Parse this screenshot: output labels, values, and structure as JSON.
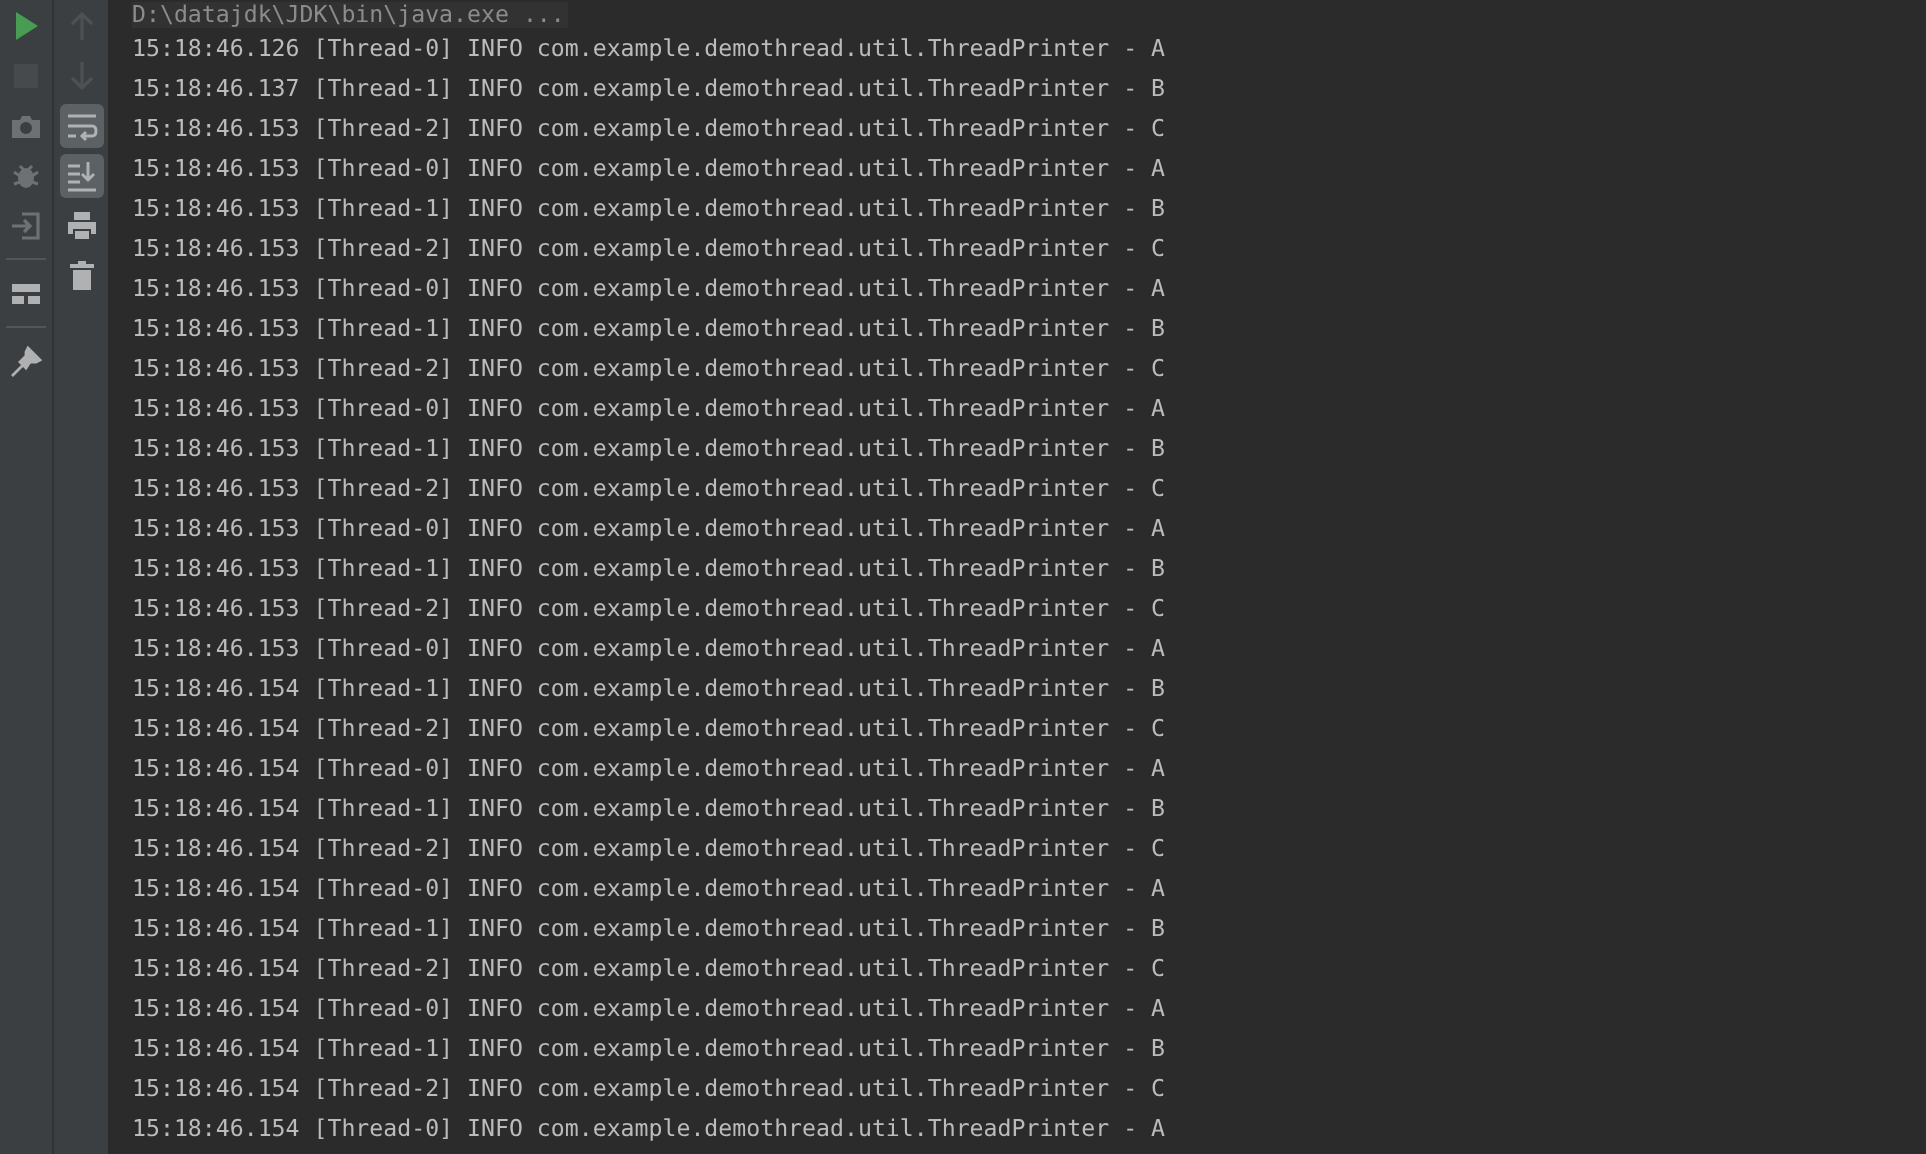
{
  "left_toolbar": [
    {
      "disabled": false
    },
    {
      "disabled": true
    },
    {
      "disabled": false
    },
    {
      "disabled": false
    },
    {
      "disabled": false
    },
    {
      "disabled": false
    },
    {
      "disabled": false
    }
  ],
  "console_toolbar": [
    {
      "disabled": true,
      "on": false
    },
    {
      "disabled": true,
      "on": false
    },
    {
      "disabled": false,
      "on": true
    },
    {
      "disabled": false,
      "on": true
    },
    {
      "disabled": false,
      "on": false
    },
    {
      "disabled": false,
      "on": false
    }
  ],
  "command_line": "D:\\datajdk\\JDK\\bin\\java.exe ...",
  "lines": [
    "15:18:46.126 [Thread-0] INFO com.example.demothread.util.ThreadPrinter - A",
    "15:18:46.137 [Thread-1] INFO com.example.demothread.util.ThreadPrinter - B",
    "15:18:46.153 [Thread-2] INFO com.example.demothread.util.ThreadPrinter - C",
    "15:18:46.153 [Thread-0] INFO com.example.demothread.util.ThreadPrinter - A",
    "15:18:46.153 [Thread-1] INFO com.example.demothread.util.ThreadPrinter - B",
    "15:18:46.153 [Thread-2] INFO com.example.demothread.util.ThreadPrinter - C",
    "15:18:46.153 [Thread-0] INFO com.example.demothread.util.ThreadPrinter - A",
    "15:18:46.153 [Thread-1] INFO com.example.demothread.util.ThreadPrinter - B",
    "15:18:46.153 [Thread-2] INFO com.example.demothread.util.ThreadPrinter - C",
    "15:18:46.153 [Thread-0] INFO com.example.demothread.util.ThreadPrinter - A",
    "15:18:46.153 [Thread-1] INFO com.example.demothread.util.ThreadPrinter - B",
    "15:18:46.153 [Thread-2] INFO com.example.demothread.util.ThreadPrinter - C",
    "15:18:46.153 [Thread-0] INFO com.example.demothread.util.ThreadPrinter - A",
    "15:18:46.153 [Thread-1] INFO com.example.demothread.util.ThreadPrinter - B",
    "15:18:46.153 [Thread-2] INFO com.example.demothread.util.ThreadPrinter - C",
    "15:18:46.153 [Thread-0] INFO com.example.demothread.util.ThreadPrinter - A",
    "15:18:46.154 [Thread-1] INFO com.example.demothread.util.ThreadPrinter - B",
    "15:18:46.154 [Thread-2] INFO com.example.demothread.util.ThreadPrinter - C",
    "15:18:46.154 [Thread-0] INFO com.example.demothread.util.ThreadPrinter - A",
    "15:18:46.154 [Thread-1] INFO com.example.demothread.util.ThreadPrinter - B",
    "15:18:46.154 [Thread-2] INFO com.example.demothread.util.ThreadPrinter - C",
    "15:18:46.154 [Thread-0] INFO com.example.demothread.util.ThreadPrinter - A",
    "15:18:46.154 [Thread-1] INFO com.example.demothread.util.ThreadPrinter - B",
    "15:18:46.154 [Thread-2] INFO com.example.demothread.util.ThreadPrinter - C",
    "15:18:46.154 [Thread-0] INFO com.example.demothread.util.ThreadPrinter - A",
    "15:18:46.154 [Thread-1] INFO com.example.demothread.util.ThreadPrinter - B",
    "15:18:46.154 [Thread-2] INFO com.example.demothread.util.ThreadPrinter - C",
    "15:18:46.154 [Thread-0] INFO com.example.demothread.util.ThreadPrinter - A"
  ]
}
